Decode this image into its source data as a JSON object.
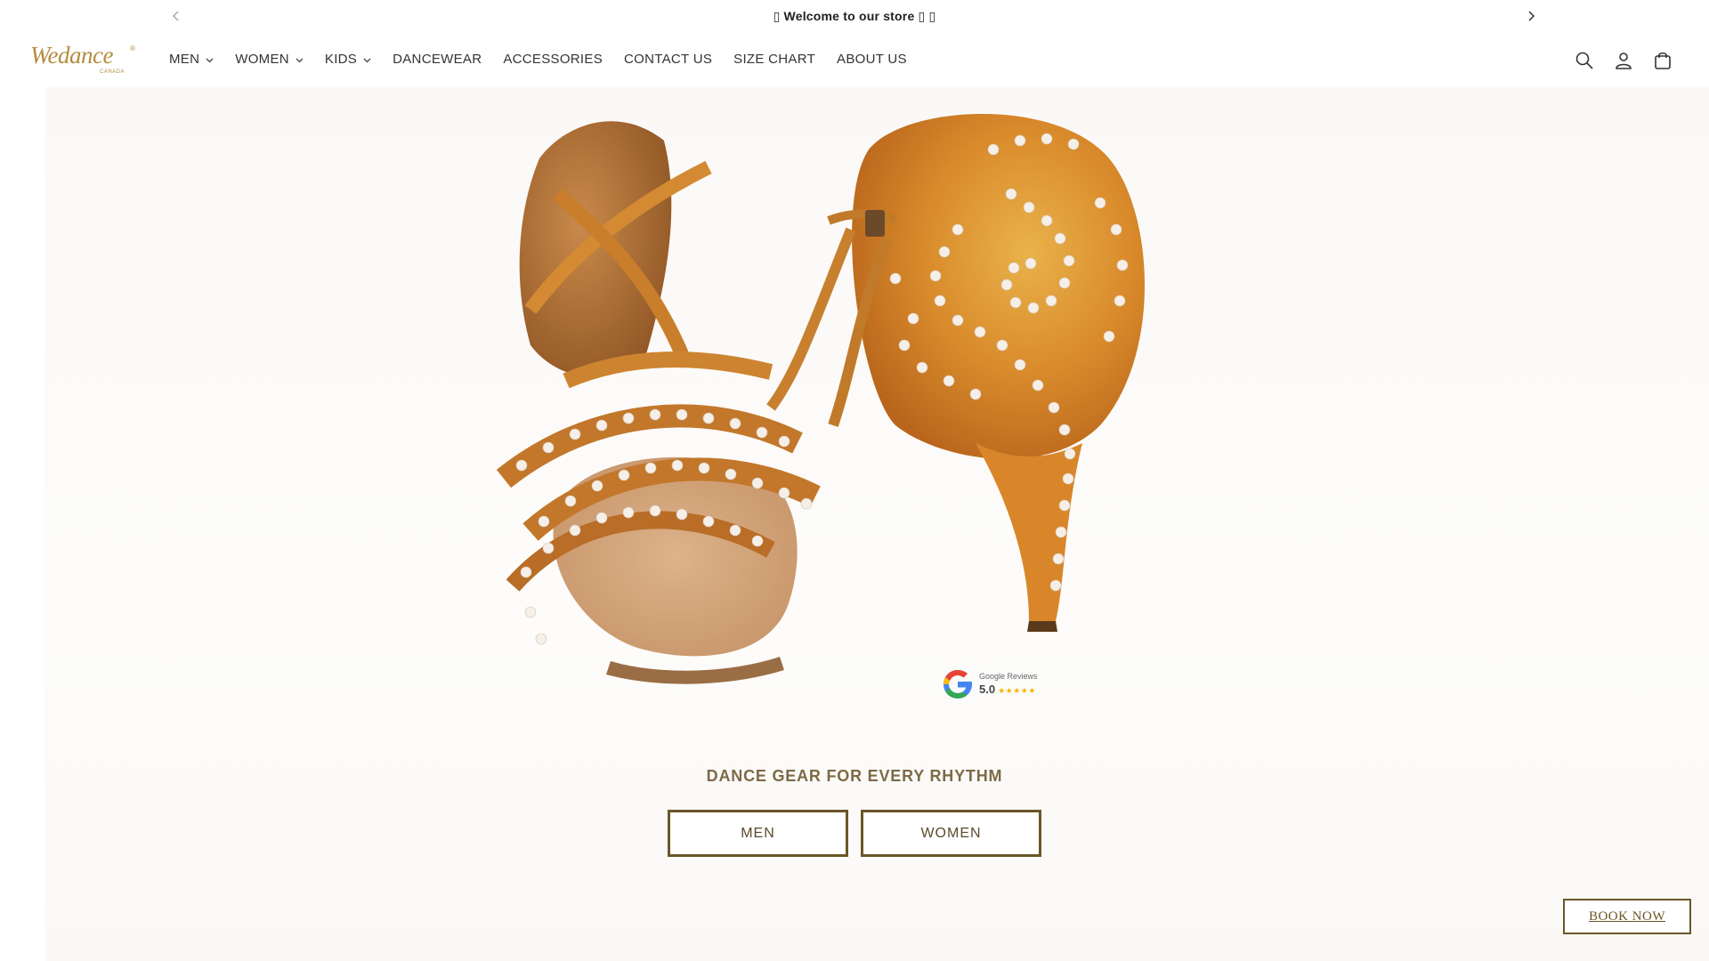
{
  "announcement": {
    "text": "▯ Welcome to our store ▯ ▯",
    "prev_icon": "chevron-left-icon",
    "next_icon": "chevron-right-icon"
  },
  "brand": {
    "logo_text": "Wedance",
    "logo_sub": "CANADA",
    "logo_mark": "®",
    "color": "#b48c3d"
  },
  "nav": {
    "items": [
      {
        "label": "MEN",
        "has_dropdown": true
      },
      {
        "label": "WOMEN",
        "has_dropdown": true
      },
      {
        "label": "KIDS",
        "has_dropdown": true
      },
      {
        "label": "DANCEWEAR",
        "has_dropdown": false
      },
      {
        "label": "ACCESSORIES",
        "has_dropdown": false
      },
      {
        "label": "CONTACT US",
        "has_dropdown": false
      },
      {
        "label": "SIZE CHART",
        "has_dropdown": false
      },
      {
        "label": "ABOUT US",
        "has_dropdown": false
      }
    ]
  },
  "header_icons": [
    "search-icon",
    "account-icon",
    "cart-icon"
  ],
  "hero": {
    "image": "orange-satin-latin-dance-shoes-with-rhinestones",
    "reviews_badge": {
      "title": "Google Reviews",
      "score": "5.0",
      "stars": "★★★★★"
    },
    "headline": "DANCE GEAR FOR EVERY RHYTHM",
    "buttons": {
      "men": "MEN",
      "women": "WOMEN"
    }
  },
  "book_now": "BOOK NOW",
  "colors": {
    "accent": "#6b5626",
    "headline": "#7d6a45",
    "shoe_satin": "#d98a2b",
    "sole": "#d9a878"
  }
}
